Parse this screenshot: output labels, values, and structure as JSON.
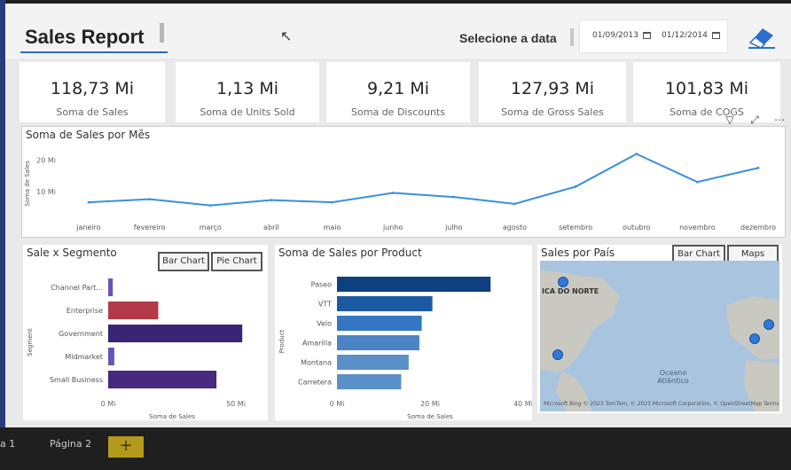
{
  "header": {
    "title": "Sales Report",
    "date_label": "Selecione a data",
    "date_start": "01/09/2013",
    "date_end": "01/12/2014"
  },
  "kpis": [
    {
      "value": "118,73 Mi",
      "label": "Soma de  Sales"
    },
    {
      "value": "1,13 Mi",
      "label": "Soma de Units Sold"
    },
    {
      "value": "9,21 Mi",
      "label": "Soma de Discounts"
    },
    {
      "value": "127,93 Mi",
      "label": "Soma de Gross Sales"
    },
    {
      "value": "101,83 Mi",
      "label": "Soma de COGS"
    }
  ],
  "line_panel": {
    "title": "Soma de Sales por Mês",
    "ylabel": "Soma de Sales"
  },
  "segment_panel": {
    "title": "Sale x Segmento",
    "btn_bar": "Bar Chart",
    "btn_pie": "Pie Chart"
  },
  "product_panel": {
    "title": "Soma de Sales por Product"
  },
  "country_panel": {
    "title": "Sales por País",
    "btn_bar": "Bar Chart",
    "btn_maps": "Maps",
    "map_label_north": "ICA DO NORTE",
    "map_label_ocean": "Oceano Atlântico",
    "map_copyright": "Microsoft Bing  © 2023 TomTom, © 2023 Microsoft Corporation, © OpenStreetMap  Terms"
  },
  "footer": {
    "tab1": "a 1",
    "tab2": "Página 2",
    "add": "+"
  },
  "colors": {
    "line": "#3a8fdc",
    "accent": "#2e6bb5"
  },
  "chart_data": [
    {
      "type": "line",
      "title": "Soma de Sales por Mês",
      "ylabel": "Soma de Sales",
      "categories": [
        "janeiro",
        "fevereiro",
        "março",
        "abril",
        "maio",
        "junho",
        "julho",
        "agosto",
        "setembro",
        "outubro",
        "novembro",
        "dezembro"
      ],
      "values": [
        6.5,
        7.5,
        5.5,
        7.2,
        6.5,
        9.5,
        8.2,
        6.0,
        11.5,
        22.0,
        13.0,
        17.5
      ],
      "ylim": [
        0,
        25
      ],
      "yticks": [
        10,
        20
      ],
      "ytick_labels": [
        "10 Mi",
        "20 Mi"
      ]
    },
    {
      "type": "bar",
      "orientation": "horizontal",
      "title": "Sale x Segmento",
      "xlabel": "Soma de Sales",
      "ylabel": "Segment",
      "categories": [
        "Channel Part...",
        "Enterprise",
        "Government",
        "Midmarket",
        "Small Business"
      ],
      "values": [
        1.8,
        19.6,
        52.5,
        2.4,
        42.4
      ],
      "colors": [
        "#6b53b8",
        "#b33a48",
        "#3a2474",
        "#6b53b8",
        "#47287f"
      ],
      "xlim": [
        0,
        50
      ],
      "xticks": [
        0,
        50
      ],
      "xtick_labels": [
        "0 Mi",
        "50 Mi"
      ]
    },
    {
      "type": "bar",
      "orientation": "horizontal",
      "title": "Soma de Sales por Product",
      "xlabel": "Soma de Sales",
      "ylabel": "Product",
      "categories": [
        "Paseo",
        "VTT",
        "Velo",
        "Amarilla",
        "Montana",
        "Carretera"
      ],
      "values": [
        33.0,
        20.5,
        18.2,
        17.7,
        15.4,
        13.8
      ],
      "colors": [
        "#0e3f7e",
        "#1b5aa3",
        "#3476c1",
        "#4a84c6",
        "#5b8fc8",
        "#5b8fc8"
      ],
      "xlim": [
        0,
        40
      ],
      "xticks": [
        0,
        20,
        40
      ],
      "xtick_labels": [
        "0 Mi",
        "20 Mi",
        "40 Mi"
      ]
    }
  ]
}
